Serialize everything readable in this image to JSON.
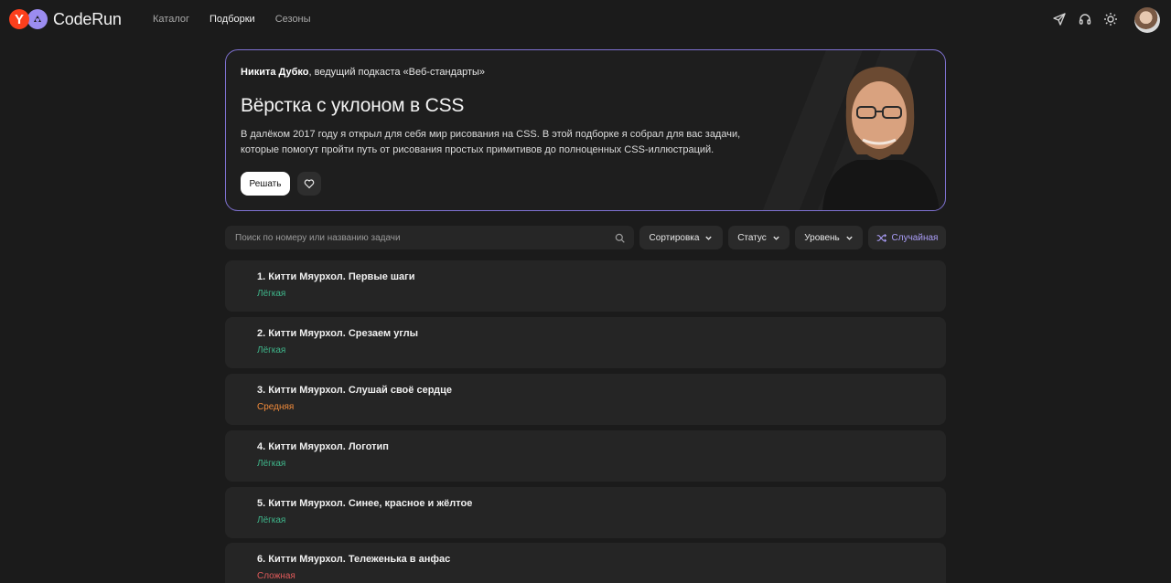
{
  "brand": {
    "name": "CodeRun",
    "y_letter": "Y"
  },
  "nav": [
    {
      "label": "Каталог",
      "active": false
    },
    {
      "label": "Подборки",
      "active": true
    },
    {
      "label": "Сезоны",
      "active": false
    }
  ],
  "header_icons": [
    "send-icon",
    "headset-icon",
    "sun-icon"
  ],
  "banner": {
    "author_name": "Никита Дубко",
    "author_role": ", ведущий подкаста «Веб-стандарты»",
    "title": "Вёрстка с уклоном в CSS",
    "description": "В далёком 2017 году я открыл для себя мир рисования на CSS. В этой подборке я собрал для вас задачи, которые помогут пройти путь от рисования простых примитивов до полноценных CSS-иллюстраций.",
    "solve_label": "Решать",
    "border_color": "#7f72d2"
  },
  "search": {
    "placeholder": "Поиск по номеру или названию задачи",
    "value": ""
  },
  "filters": {
    "sort_label": "Сортировка",
    "status_label": "Статус",
    "level_label": "Уровень",
    "random_label": "Случайная"
  },
  "colors": {
    "easy": "#3fb68b",
    "medium": "#f08a3a",
    "hard": "#e05a5a",
    "accent": "#a99cf5"
  },
  "tasks": [
    {
      "title": "1. Китти Мяурхол. Первые шаги",
      "level": "Лёгкая",
      "level_color": "#3fb68b"
    },
    {
      "title": "2. Китти Мяурхол. Срезаем углы",
      "level": "Лёгкая",
      "level_color": "#3fb68b"
    },
    {
      "title": "3. Китти Мяурхол. Слушай своё сердце",
      "level": "Средняя",
      "level_color": "#f08a3a"
    },
    {
      "title": "4. Китти Мяурхол. Логотип",
      "level": "Лёгкая",
      "level_color": "#3fb68b"
    },
    {
      "title": "5. Китти Мяурхол. Синее, красное и жёлтое",
      "level": "Лёгкая",
      "level_color": "#3fb68b"
    },
    {
      "title": "6. Китти Мяурхол. Тележенька в анфас",
      "level": "Сложная",
      "level_color": "#e05a5a"
    }
  ]
}
